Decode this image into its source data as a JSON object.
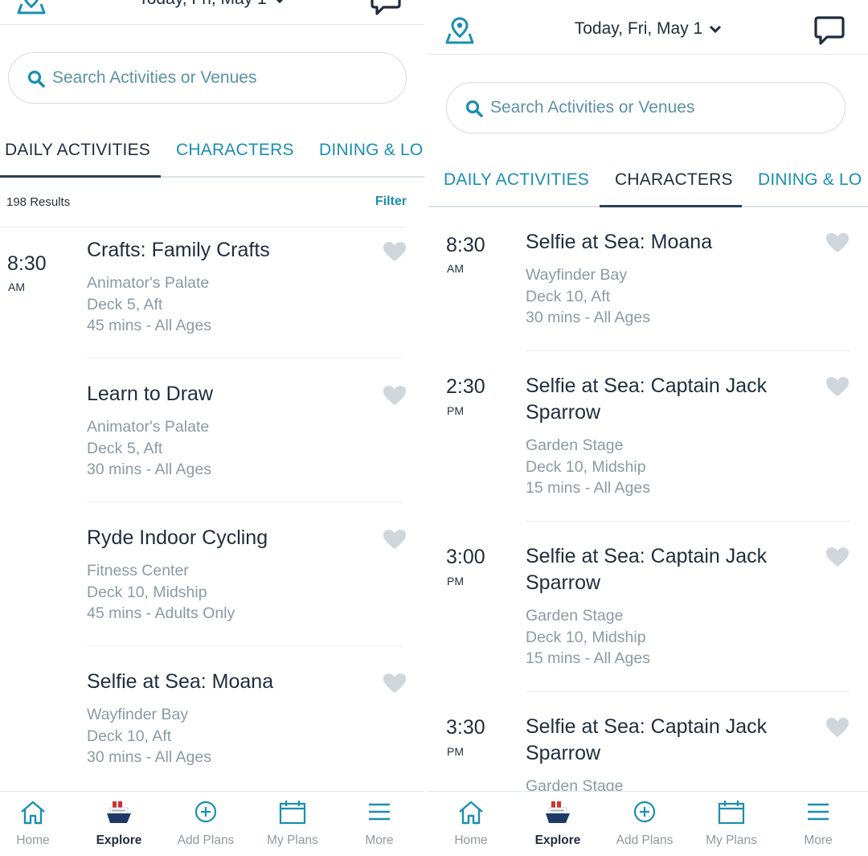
{
  "header": {
    "date_label": "Today, Fri, May 1"
  },
  "search": {
    "placeholder": "Search Activities or Venues"
  },
  "tabs": [
    "DAILY ACTIVITIES",
    "CHARACTERS",
    "DINING & LO"
  ],
  "left": {
    "results_count": "198 Results",
    "filter_label": "Filter",
    "items": [
      {
        "time": "8:30",
        "ampm": "AM",
        "title": "Crafts: Family Crafts",
        "venue": "Animator's Palate",
        "deck": "Deck 5, Aft",
        "duration": "45 mins - All Ages"
      },
      {
        "time": "",
        "ampm": "",
        "title": "Learn to Draw",
        "venue": "Animator's Palate",
        "deck": "Deck 5, Aft",
        "duration": "30 mins - All Ages"
      },
      {
        "time": "",
        "ampm": "",
        "title": "Ryde Indoor Cycling",
        "venue": "Fitness Center",
        "deck": "Deck 10, Midship",
        "duration": "45 mins - Adults Only"
      },
      {
        "time": "",
        "ampm": "",
        "title": "Selfie at Sea: Moana",
        "venue": "Wayfinder Bay",
        "deck": "Deck 10, Aft",
        "duration": "30 mins - All Ages"
      }
    ]
  },
  "right": {
    "items": [
      {
        "time": "8:30",
        "ampm": "AM",
        "title": "Selfie at Sea: Moana",
        "venue": "Wayfinder Bay",
        "deck": "Deck 10, Aft",
        "duration": "30 mins - All Ages"
      },
      {
        "time": "2:30",
        "ampm": "PM",
        "title": "Selfie at Sea: Captain Jack Sparrow",
        "venue": "Garden Stage",
        "deck": "Deck 10, Midship",
        "duration": "15 mins - All Ages"
      },
      {
        "time": "3:00",
        "ampm": "PM",
        "title": "Selfie at Sea: Captain Jack Sparrow",
        "venue": "Garden Stage",
        "deck": "Deck 10, Midship",
        "duration": "15 mins - All Ages"
      },
      {
        "time": "3:30",
        "ampm": "PM",
        "title": "Selfie at Sea: Captain Jack Sparrow",
        "venue": "Garden Stage",
        "deck": "",
        "duration": ""
      }
    ]
  },
  "nav": [
    "Home",
    "Explore",
    "Add Plans",
    "My Plans",
    "More"
  ],
  "icons": {
    "map": "map-pin-icon",
    "chat": "chat-bubble-icon",
    "search": "search-icon",
    "chevron": "chevron-down-icon",
    "heart": "heart-icon",
    "home": "home-icon",
    "explore": "ship-icon",
    "add": "plus-circle-icon",
    "plans": "calendar-icon",
    "more": "hamburger-menu-icon"
  },
  "colors": {
    "accent": "#1a8fb0",
    "text": "#1f2d3d",
    "muted": "#8a9aa7",
    "heart": "#cfd6dc",
    "ship_red": "#d2312f",
    "ship_navy": "#1f3a66"
  }
}
